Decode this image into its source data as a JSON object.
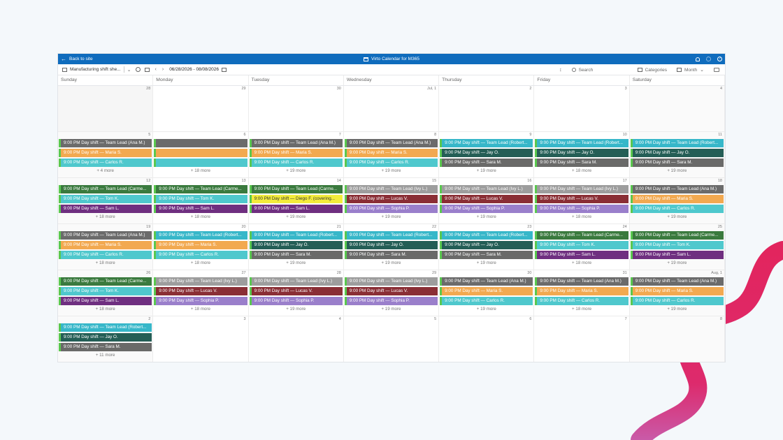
{
  "topbar": {
    "back_label": "Back to site",
    "title": "Virto Calendar for M365"
  },
  "toolbar": {
    "calendar_name": "Manufacturing shift she...",
    "date_range": "06/28/2026 - 08/08/2026",
    "search_placeholder": "Search",
    "categories_label": "Categories",
    "view_label": "Month"
  },
  "colors": {
    "teamlead_dark": "#3a7a3e",
    "teamlead_gray": "#6b6b6b",
    "teamlead_cyan": "#37b7c9",
    "orange": "#f2a950",
    "cyan": "#4fc8cd",
    "teal": "#245e56",
    "gray": "#6a6a69",
    "purple": "#6f2f80",
    "lavender": "#9a7fcb",
    "maroon": "#8a2e35",
    "yellow": "#f3ec3b",
    "lightgray": "#9d9d9d"
  },
  "weekdays": [
    "Sunday",
    "Monday",
    "Tuesday",
    "Wednesday",
    "Thursday",
    "Friday",
    "Saturday"
  ],
  "weeks": [
    [
      {
        "day": "28",
        "out": true,
        "events": [],
        "more": ""
      },
      {
        "day": "29",
        "out": false,
        "events": [],
        "more": ""
      },
      {
        "day": "30",
        "out": false,
        "events": [],
        "more": ""
      },
      {
        "day": "Jul, 1",
        "out": false,
        "events": [],
        "more": ""
      },
      {
        "day": "2",
        "out": false,
        "events": [],
        "more": ""
      },
      {
        "day": "3",
        "out": false,
        "events": [],
        "more": ""
      },
      {
        "day": "4",
        "out": false,
        "events": [],
        "more": ""
      }
    ],
    [
      {
        "day": "5",
        "events": [
          {
            "text": "9:00 PM Day shift — Team Lead (Ana M.)",
            "color": "#6b6b6b"
          },
          {
            "text": "9:00 PM Day shift — Maria S.",
            "color": "#f2a950"
          },
          {
            "text": "9:00 PM Day shift — Carlos R.",
            "color": "#4fc8cd"
          }
        ],
        "more": "+ 4 more"
      },
      {
        "day": "6",
        "events": [
          {
            "text": "",
            "color": "#6b6b6b"
          },
          {
            "text": "",
            "color": "#f2a950"
          },
          {
            "text": "",
            "color": "#4fc8cd"
          }
        ],
        "more": "+ 18 more"
      },
      {
        "day": "7",
        "events": [
          {
            "text": "9:00 PM Day shift — Team Lead (Ana M.)",
            "color": "#6b6b6b"
          },
          {
            "text": "9:00 PM Day shift — Maria S.",
            "color": "#f2a950"
          },
          {
            "text": "9:00 PM Day shift — Carlos R.",
            "color": "#4fc8cd"
          }
        ],
        "more": "+ 19 more"
      },
      {
        "day": "8",
        "events": [
          {
            "text": "9:00 PM Day shift — Team Lead (Ana M.)",
            "color": "#6b6b6b"
          },
          {
            "text": "9:00 PM Day shift — Maria S.",
            "color": "#f2a950"
          },
          {
            "text": "9:00 PM Day shift — Carlos R.",
            "color": "#4fc8cd"
          }
        ],
        "more": "+ 19 more"
      },
      {
        "day": "9",
        "events": [
          {
            "text": "9:00 PM Day shift — Team Lead (Robert...",
            "color": "#37b7c9"
          },
          {
            "text": "9:00 PM Day shift — Jay O.",
            "color": "#245e56"
          },
          {
            "text": "9:00 PM Day shift — Sara M.",
            "color": "#6a6a69"
          }
        ],
        "more": "+ 19 more"
      },
      {
        "day": "10",
        "events": [
          {
            "text": "9:00 PM Day shift — Team Lead (Robert...",
            "color": "#37b7c9"
          },
          {
            "text": "9:00 PM Day shift — Jay O.",
            "color": "#245e56"
          },
          {
            "text": "9:00 PM Day shift — Sara M.",
            "color": "#6a6a69"
          }
        ],
        "more": "+ 18 more"
      },
      {
        "day": "11",
        "events": [
          {
            "text": "9:00 PM Day shift — Team Lead (Robert...",
            "color": "#37b7c9"
          },
          {
            "text": "9:00 PM Day shift — Jay O.",
            "color": "#245e56"
          },
          {
            "text": "9:00 PM Day shift — Sara M.",
            "color": "#6a6a69"
          }
        ],
        "more": "+ 19 more"
      }
    ],
    [
      {
        "day": "12",
        "events": [
          {
            "text": "9:00 PM Day shift — Team Lead (Carme...",
            "color": "#3a7a3e"
          },
          {
            "text": "9:00 PM Day shift — Tom K.",
            "color": "#4fc8cd"
          },
          {
            "text": "9:00 PM Day shift — Sam L.",
            "color": "#6f2f80"
          }
        ],
        "more": "+ 18 more"
      },
      {
        "day": "13",
        "events": [
          {
            "text": "9:00 PM Day shift — Team Lead (Carme...",
            "color": "#3a7a3e"
          },
          {
            "text": "9:00 PM Day shift — Tom K.",
            "color": "#4fc8cd"
          },
          {
            "text": "9:00 PM Day shift — Sam L.",
            "color": "#6f2f80"
          }
        ],
        "more": "+ 18 more"
      },
      {
        "day": "14",
        "events": [
          {
            "text": "9:00 PM Day shift — Team Lead (Carme...",
            "color": "#3a7a3e"
          },
          {
            "text": "9:00 PM Day shift — Diego F. (covering...",
            "color": "#f3ec3b",
            "dark": true
          },
          {
            "text": "9:00 PM Day shift — Sam L.",
            "color": "#6f2f80"
          }
        ],
        "more": "+ 19 more"
      },
      {
        "day": "15",
        "events": [
          {
            "text": "9:00 PM Day shift — Team Lead (Ivy L.)",
            "color": "#9d9d9d"
          },
          {
            "text": "9:00 PM Day shift — Lucas V.",
            "color": "#8a2e35"
          },
          {
            "text": "9:00 PM Day shift — Sophia P.",
            "color": "#9a7fcb"
          }
        ],
        "more": "+ 19 more"
      },
      {
        "day": "16",
        "events": [
          {
            "text": "9:00 PM Day shift — Team Lead (Ivy L.)",
            "color": "#9d9d9d"
          },
          {
            "text": "9:00 PM Day shift — Lucas V.",
            "color": "#8a2e35"
          },
          {
            "text": "9:00 PM Day shift — Sophia P.",
            "color": "#9a7fcb"
          }
        ],
        "more": "+ 19 more"
      },
      {
        "day": "17",
        "events": [
          {
            "text": "9:00 PM Day shift — Team Lead (Ivy L.)",
            "color": "#9d9d9d"
          },
          {
            "text": "9:00 PM Day shift — Lucas V.",
            "color": "#8a2e35"
          },
          {
            "text": "9:00 PM Day shift — Sophia P.",
            "color": "#9a7fcb"
          }
        ],
        "more": "+ 18 more"
      },
      {
        "day": "18",
        "events": [
          {
            "text": "9:00 PM Day shift — Team Lead (Ana M.)",
            "color": "#6b6b6b"
          },
          {
            "text": "9:00 PM Day shift — Maria S.",
            "color": "#f2a950"
          },
          {
            "text": "9:00 PM Day shift — Carlos R.",
            "color": "#4fc8cd"
          }
        ],
        "more": "+ 19 more"
      }
    ],
    [
      {
        "day": "19",
        "events": [
          {
            "text": "9:00 PM Day shift — Team Lead (Ana M.)",
            "color": "#6b6b6b"
          },
          {
            "text": "9:00 PM Day shift — Maria S.",
            "color": "#f2a950"
          },
          {
            "text": "9:00 PM Day shift — Carlos R.",
            "color": "#4fc8cd"
          }
        ],
        "more": "+ 18 more"
      },
      {
        "day": "20",
        "events": [
          {
            "text": "9:00 PM Day shift — Team Lead (Robert...",
            "color": "#37b7c9"
          },
          {
            "text": "9:00 PM Day shift — Maria S.",
            "color": "#f2a950"
          },
          {
            "text": "9:00 PM Day shift — Carlos R.",
            "color": "#4fc8cd"
          }
        ],
        "more": "+ 18 more"
      },
      {
        "day": "21",
        "events": [
          {
            "text": "9:00 PM Day shift — Team Lead (Robert...",
            "color": "#37b7c9"
          },
          {
            "text": "9:00 PM Day shift — Jay O.",
            "color": "#245e56"
          },
          {
            "text": "9:00 PM Day shift — Sara M.",
            "color": "#6a6a69"
          }
        ],
        "more": "+ 19 more"
      },
      {
        "day": "22",
        "events": [
          {
            "text": "9:00 PM Day shift — Team Lead (Robert...",
            "color": "#37b7c9"
          },
          {
            "text": "9:00 PM Day shift — Jay O.",
            "color": "#245e56"
          },
          {
            "text": "9:00 PM Day shift — Sara M.",
            "color": "#6a6a69"
          }
        ],
        "more": "+ 19 more"
      },
      {
        "day": "23",
        "events": [
          {
            "text": "9:00 PM Day shift — Team Lead (Robert...",
            "color": "#37b7c9"
          },
          {
            "text": "9:00 PM Day shift — Jay O.",
            "color": "#245e56"
          },
          {
            "text": "9:00 PM Day shift — Sara M.",
            "color": "#6a6a69"
          }
        ],
        "more": "+ 19 more"
      },
      {
        "day": "24",
        "events": [
          {
            "text": "9:00 PM Day shift — Team Lead (Carme...",
            "color": "#3a7a3e"
          },
          {
            "text": "9:00 PM Day shift — Tom K.",
            "color": "#4fc8cd"
          },
          {
            "text": "9:00 PM Day shift — Sam L.",
            "color": "#6f2f80"
          }
        ],
        "more": "+ 18 more"
      },
      {
        "day": "25",
        "events": [
          {
            "text": "9:00 PM Day shift — Team Lead (Carme...",
            "color": "#3a7a3e"
          },
          {
            "text": "9:00 PM Day shift — Tom K.",
            "color": "#4fc8cd"
          },
          {
            "text": "9:00 PM Day shift — Sam L.",
            "color": "#6f2f80"
          }
        ],
        "more": "+ 19 more"
      }
    ],
    [
      {
        "day": "26",
        "events": [
          {
            "text": "9:00 PM Day shift — Team Lead (Carme...",
            "color": "#3a7a3e"
          },
          {
            "text": "9:00 PM Day shift — Tom K.",
            "color": "#4fc8cd"
          },
          {
            "text": "9:00 PM Day shift — Sam L.",
            "color": "#6f2f80"
          }
        ],
        "more": "+ 18 more"
      },
      {
        "day": "27",
        "events": [
          {
            "text": "9:00 PM Day shift — Team Lead (Ivy L.)",
            "color": "#9d9d9d"
          },
          {
            "text": "9:00 PM Day shift — Lucas V.",
            "color": "#8a2e35"
          },
          {
            "text": "9:00 PM Day shift — Sophia P.",
            "color": "#9a7fcb"
          }
        ],
        "more": "+ 18 more"
      },
      {
        "day": "28",
        "events": [
          {
            "text": "9:00 PM Day shift — Team Lead (Ivy L.)",
            "color": "#9d9d9d"
          },
          {
            "text": "9:00 PM Day shift — Lucas V.",
            "color": "#8a2e35"
          },
          {
            "text": "9:00 PM Day shift — Sophia P.",
            "color": "#9a7fcb"
          }
        ],
        "more": "+ 19 more"
      },
      {
        "day": "29",
        "events": [
          {
            "text": "9:00 PM Day shift — Team Lead (Ivy L.)",
            "color": "#9d9d9d"
          },
          {
            "text": "9:00 PM Day shift — Lucas V.",
            "color": "#8a2e35"
          },
          {
            "text": "9:00 PM Day shift — Sophia P.",
            "color": "#9a7fcb"
          }
        ],
        "more": "+ 19 more"
      },
      {
        "day": "30",
        "events": [
          {
            "text": "9:00 PM Day shift — Team Lead (Ana M.)",
            "color": "#6b6b6b"
          },
          {
            "text": "9:00 PM Day shift — Maria S.",
            "color": "#f2a950"
          },
          {
            "text": "9:00 PM Day shift — Carlos R.",
            "color": "#4fc8cd"
          }
        ],
        "more": "+ 19 more"
      },
      {
        "day": "31",
        "events": [
          {
            "text": "9:00 PM Day shift — Team Lead (Ana M.)",
            "color": "#6b6b6b"
          },
          {
            "text": "9:00 PM Day shift — Maria S.",
            "color": "#f2a950"
          },
          {
            "text": "9:00 PM Day shift — Carlos R.",
            "color": "#4fc8cd"
          }
        ],
        "more": "+ 18 more"
      },
      {
        "day": "Aug, 1",
        "events": [
          {
            "text": "9:00 PM Day shift — Team Lead (Ana M.)",
            "color": "#6b6b6b"
          },
          {
            "text": "9:00 PM Day shift — Maria S.",
            "color": "#f2a950"
          },
          {
            "text": "9:00 PM Day shift — Carlos R.",
            "color": "#4fc8cd"
          }
        ],
        "more": "+ 19 more"
      }
    ],
    [
      {
        "day": "2",
        "events": [
          {
            "text": "9:00 PM Day shift — Team Lead (Robert...",
            "color": "#37b7c9"
          },
          {
            "text": "9:00 PM Day shift — Jay O.",
            "color": "#245e56"
          },
          {
            "text": "9:00 PM Day shift — Sara M.",
            "color": "#6a6a69"
          }
        ],
        "more": "+ 11 more"
      },
      {
        "day": "3",
        "events": [],
        "more": ""
      },
      {
        "day": "4",
        "events": [],
        "more": ""
      },
      {
        "day": "5",
        "events": [],
        "more": ""
      },
      {
        "day": "6",
        "events": [],
        "more": ""
      },
      {
        "day": "7",
        "events": [],
        "more": ""
      },
      {
        "day": "8",
        "events": [],
        "more": ""
      }
    ]
  ]
}
